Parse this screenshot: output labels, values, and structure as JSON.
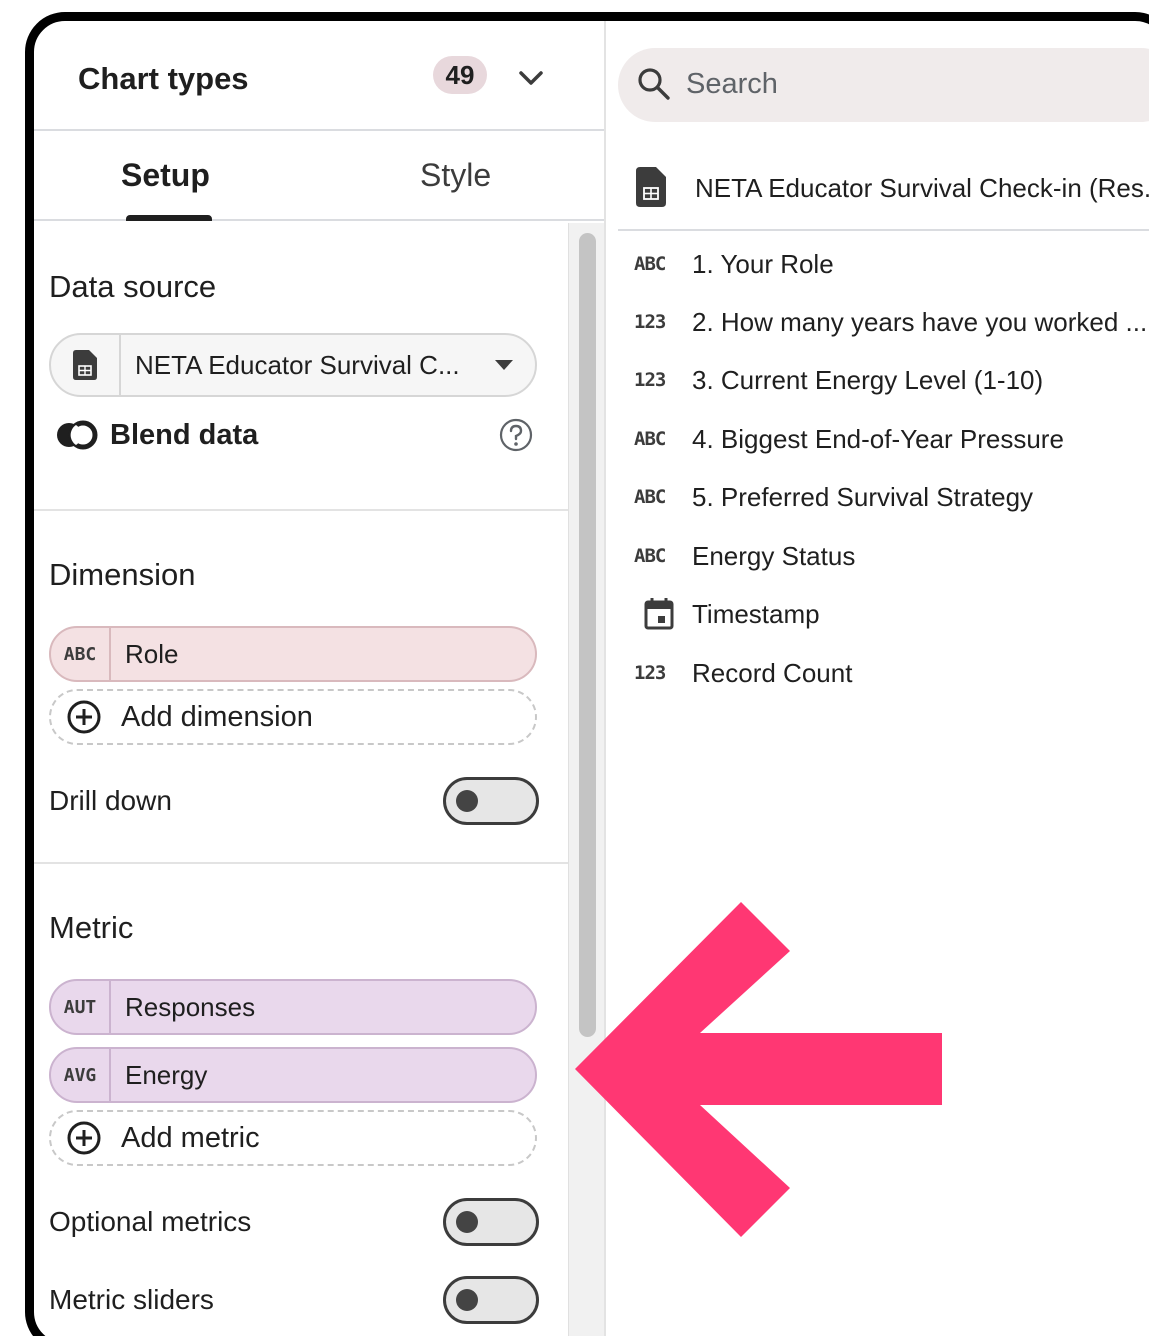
{
  "header": {
    "title": "Chart types",
    "count": "49"
  },
  "tabs": [
    {
      "label": "Setup",
      "active": true
    },
    {
      "label": "Style",
      "active": false
    }
  ],
  "data_source": {
    "title": "Data source",
    "selected": "NETA Educator Survival C...",
    "blend_label": "Blend data"
  },
  "dimension": {
    "title": "Dimension",
    "fields": [
      {
        "type": "ABC",
        "name": "Role"
      }
    ],
    "add_label": "Add dimension",
    "drill_down_label": "Drill down"
  },
  "metric": {
    "title": "Metric",
    "fields": [
      {
        "type": "AUT",
        "name": "Responses"
      },
      {
        "type": "AVG",
        "name": "Energy"
      }
    ],
    "add_label": "Add metric",
    "optional_metrics_label": "Optional metrics",
    "metric_sliders_label": "Metric sliders"
  },
  "right_panel": {
    "search_placeholder": "Search",
    "source_name": "NETA Educator Survival Check-in (Res...",
    "fields": [
      {
        "type": "ABC",
        "name": "1. Your Role"
      },
      {
        "type": "123",
        "name": "2. How many years have you worked ..."
      },
      {
        "type": "123",
        "name": "3. Current Energy Level (1-10)"
      },
      {
        "type": "ABC",
        "name": "4. Biggest End-of-Year Pressure"
      },
      {
        "type": "ABC",
        "name": "5. Preferred Survival Strategy"
      },
      {
        "type": "ABC",
        "name": "Energy Status"
      },
      {
        "type": "calendar-icon",
        "name": "Timestamp"
      },
      {
        "type": "123",
        "name": "Record Count"
      }
    ]
  },
  "colors": {
    "arrow": "#ff3773",
    "dimension_pill": "#f4e1e3",
    "metric_pill": "#e9d8ec",
    "count_badge": "#e8d8dc"
  }
}
